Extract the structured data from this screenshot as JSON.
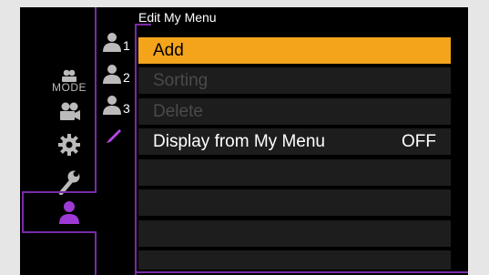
{
  "screen": {
    "title": "Edit My Menu",
    "tabs": [
      {
        "icon": "mode-icon",
        "label": "MODE"
      },
      {
        "icon": "movie-camera-icon"
      },
      {
        "icon": "gear-icon"
      },
      {
        "icon": "wrench-icon"
      },
      {
        "icon": "my-menu-person-icon",
        "selected": true
      }
    ],
    "subtabs": [
      {
        "icon": "person-icon",
        "label": "1"
      },
      {
        "icon": "person-icon",
        "label": "2"
      },
      {
        "icon": "person-icon",
        "label": "3"
      },
      {
        "icon": "pencil-icon",
        "selected": true
      }
    ],
    "menu": [
      {
        "label": "Add",
        "state": "selected"
      },
      {
        "label": "Sorting",
        "state": "disabled"
      },
      {
        "label": "Delete",
        "state": "disabled"
      },
      {
        "label": "Display from My Menu",
        "value": "OFF",
        "state": "normal"
      },
      {
        "label": ""
      },
      {
        "label": ""
      },
      {
        "label": ""
      },
      {
        "label": ""
      }
    ]
  },
  "colors": {
    "selection": "#f4a41b",
    "accent": "#7a2aa8",
    "background": "#000000",
    "row": "#1d1d1d",
    "disabled_text": "#4a4a4a"
  }
}
